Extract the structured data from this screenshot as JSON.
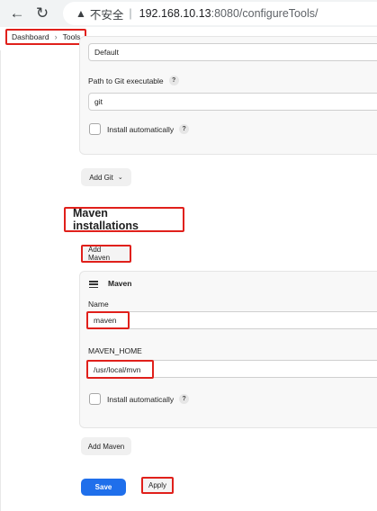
{
  "browser": {
    "warning_label": "不安全",
    "separator": "|",
    "url_host": "192.168.10.13",
    "url_rest": ":8080/configureTools/"
  },
  "breadcrumb": {
    "items": [
      "Dashboard",
      "Tools"
    ]
  },
  "git_section": {
    "default_value": "Default",
    "path_label": "Path to Git executable",
    "path_value": "git",
    "install_auto_label": "Install automatically",
    "add_git_label": "Add Git"
  },
  "maven_section": {
    "title": "Maven installations",
    "add_maven_top_label": "Add Maven",
    "card_title": "Maven",
    "name_label": "Name",
    "name_value": "maven",
    "home_label": "MAVEN_HOME",
    "home_value": "/usr/local/mvn",
    "install_auto_label": "Install automatically",
    "add_maven_bottom_label": "Add Maven"
  },
  "actions": {
    "save_label": "Save",
    "apply_label": "Apply"
  },
  "help_glyph": "?",
  "colors": {
    "primary": "#1f6feb",
    "highlight": "#e0201b"
  }
}
